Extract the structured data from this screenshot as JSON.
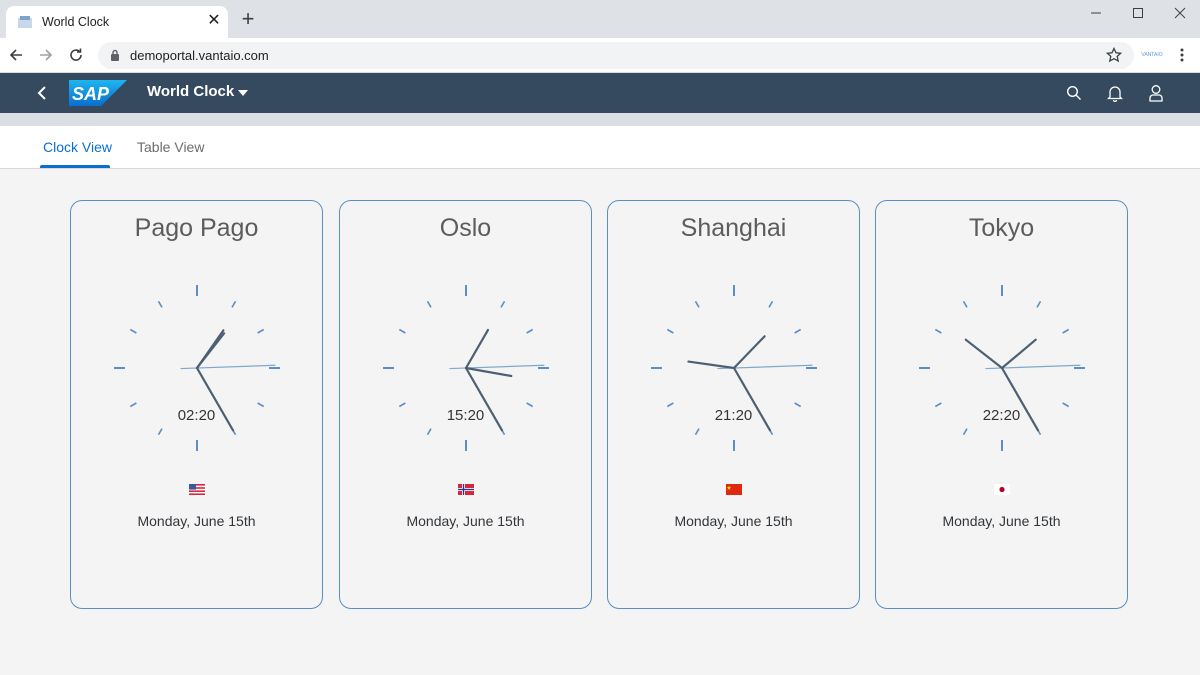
{
  "browser": {
    "tab_title": "World Clock",
    "tab_close": "✕",
    "new_tab": "+",
    "url": "demoportal.vantaio.com",
    "extension_label": "VANTAIO"
  },
  "shell": {
    "logo_text": "SAP",
    "app_title": "World Clock"
  },
  "tabs": [
    {
      "label": "Clock View",
      "active": true
    },
    {
      "label": "Table View",
      "active": false
    }
  ],
  "clocks": [
    {
      "city": "Pago Pago",
      "time": "02:20",
      "date": "Monday, June 15th",
      "flag": "us-flag-icon"
    },
    {
      "city": "Oslo",
      "time": "15:20",
      "date": "Monday, June 15th",
      "flag": "norway-flag-icon"
    },
    {
      "city": "Shanghai",
      "time": "21:20",
      "date": "Monday, June 15th",
      "flag": "china-flag-icon"
    },
    {
      "city": "Tokyo",
      "time": "22:20",
      "date": "Monday, June 15th",
      "flag": "japan-flag-icon"
    }
  ],
  "colors": {
    "shell_bar": "#354a5f",
    "accent": "#0a6ed1",
    "card_border": "#5a8ec4",
    "tick_marks": "#5b8fc7",
    "clock_hands": "#4d6073"
  }
}
